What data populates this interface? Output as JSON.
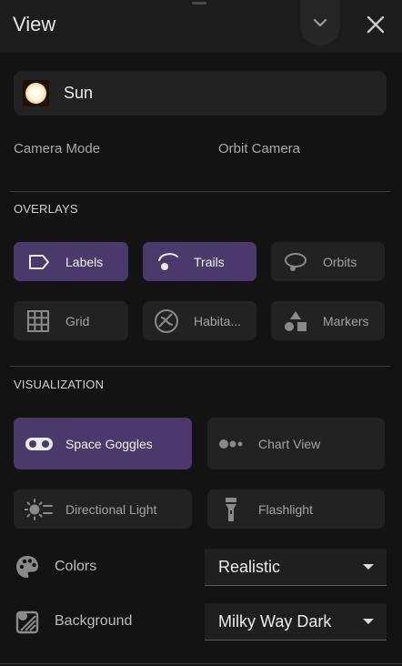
{
  "header": {
    "title": "View"
  },
  "target": {
    "name": "Sun"
  },
  "camera": {
    "label": "Camera Mode",
    "value": "Orbit Camera"
  },
  "overlays": {
    "title": "OVERLAYS",
    "buttons": [
      {
        "label": "Labels",
        "icon": "label-tag-icon",
        "active": true
      },
      {
        "label": "Trails",
        "icon": "trail-icon",
        "active": true
      },
      {
        "label": "Orbits",
        "icon": "orbit-icon",
        "active": false
      },
      {
        "label": "Grid",
        "icon": "grid-icon",
        "active": false
      },
      {
        "label": "Habita...",
        "icon": "habitable-zone-icon",
        "active": false
      },
      {
        "label": "Markers",
        "icon": "markers-icon",
        "active": false
      }
    ]
  },
  "visualization": {
    "title": "VISUALIZATION",
    "buttons": [
      {
        "label": "Space Goggles",
        "icon": "goggles-icon",
        "active": true
      },
      {
        "label": "Chart View",
        "icon": "chart-view-icon",
        "active": false
      },
      {
        "label": "Directional Light",
        "icon": "directional-light-icon",
        "active": false
      },
      {
        "label": "Flashlight",
        "icon": "flashlight-icon",
        "active": false
      }
    ]
  },
  "colors": {
    "label": "Colors",
    "value": "Realistic",
    "icon": "palette-icon"
  },
  "background": {
    "label": "Background",
    "value": "Milky Way Dark",
    "icon": "background-icon"
  },
  "theme": {
    "active_button": "#4a3a6c",
    "button": "#222222",
    "panel": "#131313"
  }
}
